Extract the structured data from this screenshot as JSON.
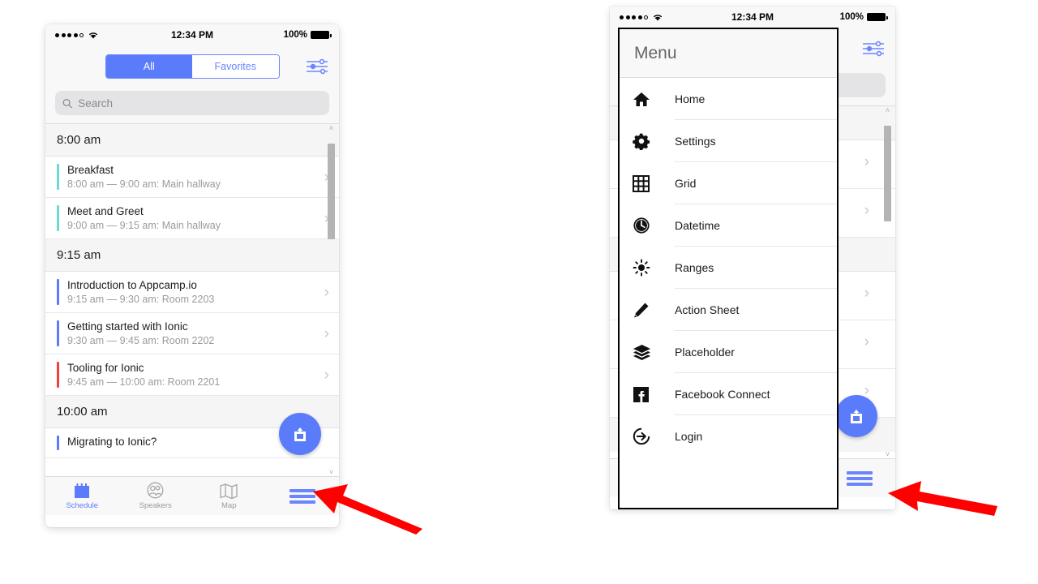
{
  "statusbar": {
    "time": "12:34 PM",
    "battery_pct": "100%",
    "signal_icon": "signal-dots-icon",
    "wifi_icon": "wifi-icon",
    "battery_icon": "battery-icon"
  },
  "left_phone": {
    "header": {
      "segments": [
        {
          "label": "All",
          "active": true
        },
        {
          "label": "Favorites",
          "active": false
        }
      ],
      "filter_icon": "filter-sliders-icon"
    },
    "search": {
      "placeholder": "Search",
      "value": "",
      "icon": "search-icon"
    },
    "groups": [
      {
        "time_label": "8:00 am",
        "items": [
          {
            "title": "Breakfast",
            "subtitle": "8:00 am — 9:00 am: Main hallway",
            "color": "#6fd8cf"
          },
          {
            "title": "Meet and Greet",
            "subtitle": "9:00 am — 9:15 am: Main hallway",
            "color": "#6fd8cf"
          }
        ]
      },
      {
        "time_label": "9:15 am",
        "items": [
          {
            "title": "Introduction to Appcamp.io",
            "subtitle": "9:15 am — 9:30 am: Room 2203",
            "color": "#5b7cfa"
          },
          {
            "title": "Getting started with Ionic",
            "subtitle": "9:30 am — 9:45 am: Room 2202",
            "color": "#5b7cfa"
          },
          {
            "title": "Tooling for Ionic",
            "subtitle": "9:45 am — 10:00 am: Room 2201",
            "color": "#f04141"
          }
        ]
      },
      {
        "time_label": "10:00 am",
        "items": [
          {
            "title": "Migrating to Ionic?",
            "subtitle": "",
            "color": "#5b7cfa"
          }
        ]
      }
    ],
    "fab": {
      "icon": "share-upload-icon",
      "color": "#5b7cfa"
    },
    "tabbar": {
      "tabs": [
        {
          "label": "Schedule",
          "icon": "calendar-icon",
          "active": true
        },
        {
          "label": "Speakers",
          "icon": "people-circle-icon",
          "active": false
        },
        {
          "label": "Map",
          "icon": "map-icon",
          "active": false
        }
      ],
      "menu_button_icon": "hamburger-menu-icon"
    },
    "scrollbar": {
      "up_arrow": "˄",
      "down_arrow": "˅"
    }
  },
  "right_phone": {
    "drawer": {
      "title": "Menu",
      "items": [
        {
          "label": "Home",
          "icon": "home-icon"
        },
        {
          "label": "Settings",
          "icon": "gear-icon"
        },
        {
          "label": "Grid",
          "icon": "grid-icon"
        },
        {
          "label": "Datetime",
          "icon": "clock-icon"
        },
        {
          "label": "Ranges",
          "icon": "brightness-sun-icon"
        },
        {
          "label": "Action Sheet",
          "icon": "pencil-icon"
        },
        {
          "label": "Placeholder",
          "icon": "layers-icon"
        },
        {
          "label": "Facebook Connect",
          "icon": "facebook-icon"
        },
        {
          "label": "Login",
          "icon": "login-arrow-icon"
        }
      ]
    },
    "filter_icon": "filter-sliders-icon",
    "fab": {
      "icon": "share-upload-icon",
      "color": "#5b7cfa"
    },
    "menu_button_icon": "hamburger-menu-icon",
    "chevron": "›"
  },
  "annotations": {
    "arrow_color": "#ff0000",
    "arrows": [
      {
        "name": "arrow-to-left-phone-menu-button"
      },
      {
        "name": "arrow-to-right-phone-menu-button"
      }
    ]
  }
}
